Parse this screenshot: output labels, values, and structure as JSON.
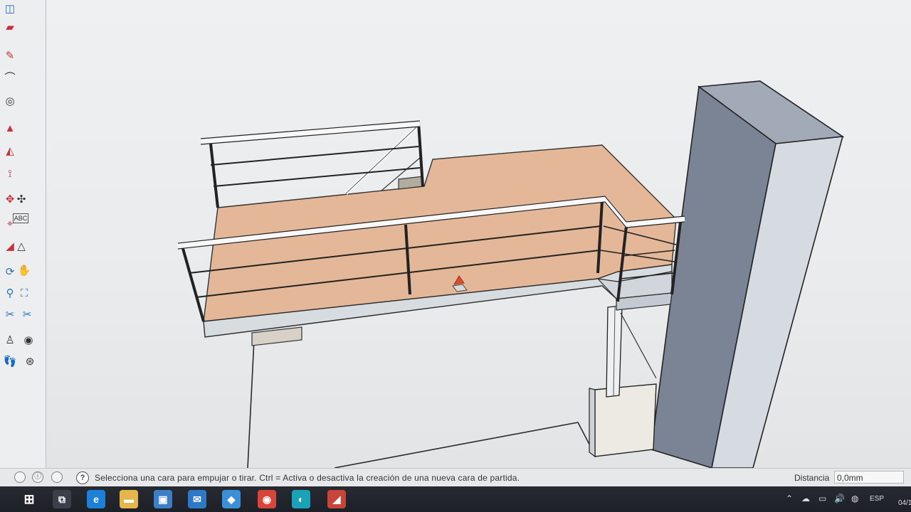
{
  "status": {
    "message": "Selecciona una cara para empujar o tirar. Ctrl = Activa o desactiva la creación de una nueva cara de partida.",
    "measurements_label": "Distancia",
    "measurements_value": "0,0mm"
  },
  "taskbar": {
    "apps": [
      {
        "name": "task-view",
        "glyph": "⧉",
        "color": "#3a3f49"
      },
      {
        "name": "edge-legacy",
        "glyph": "e",
        "color": "#1e7fd6"
      },
      {
        "name": "file-explorer",
        "glyph": "▬",
        "color": "#e5b64b"
      },
      {
        "name": "store",
        "glyph": "▣",
        "color": "#3d7fc4"
      },
      {
        "name": "mail",
        "glyph": "✉",
        "color": "#2d78c7"
      },
      {
        "name": "photos",
        "glyph": "◆",
        "color": "#3b8ed8"
      },
      {
        "name": "chrome",
        "glyph": "◉",
        "color": "#d8453b"
      },
      {
        "name": "edge",
        "glyph": "◐",
        "color": "#1aa3b8"
      },
      {
        "name": "sketchup",
        "glyph": "◢",
        "color": "#c6443a"
      }
    ],
    "tray": {
      "language": "ESP",
      "date": "04/1"
    }
  },
  "colors": {
    "floor_top": "#e2b796",
    "floor_front": "#c9a083",
    "frame": "#d9dee3",
    "column_front": "#dce1e6",
    "column_side": "#7e8697",
    "column_top": "#9aa3b3",
    "rail": "#f8f8f8"
  }
}
